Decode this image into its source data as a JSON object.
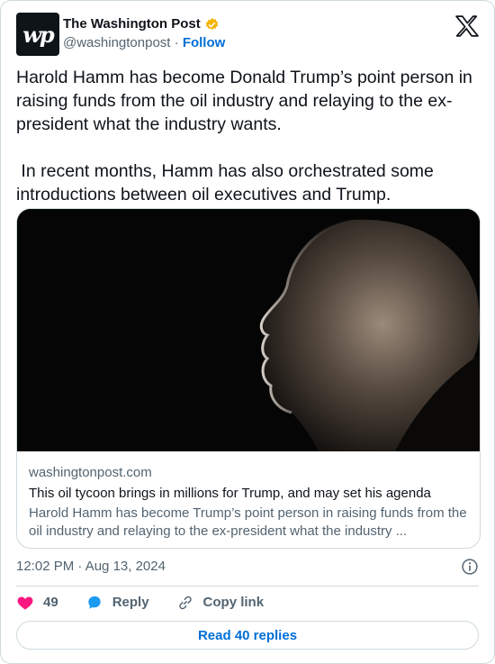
{
  "author": {
    "display_name": "The Washington Post",
    "handle": "@washingtonpost",
    "separator": "·",
    "follow_label": "Follow",
    "avatar_text": "wp",
    "verified_color": "#f4b400"
  },
  "tweet": {
    "text": "Harold Hamm has become Donald Trump’s point person in raising funds from the oil industry and relaying to the ex-president what the industry wants.\n\n In recent months, Hamm has also orchestrated some introductions between oil executives and Trump."
  },
  "link_card": {
    "domain": "washingtonpost.com",
    "title": "This oil tycoon brings in millions for Trump, and may set his agenda",
    "description": "Harold Hamm has become Trump’s point person in raising funds from the oil industry and relaying to the ex-president what the industry ..."
  },
  "timestamp": "12:02 PM · Aug 13, 2024",
  "actions": {
    "like_count": "49",
    "reply_label": "Reply",
    "copy_link_label": "Copy link"
  },
  "read_replies_label": "Read 40 replies",
  "colors": {
    "accent": "#006fd6",
    "like": "#f91880",
    "reply": "#1d9bf0",
    "muted": "#536471",
    "border": "#cfd9de"
  },
  "icons": [
    "x-logo-icon",
    "verified-badge-icon",
    "info-icon",
    "heart-icon",
    "reply-bubble-icon",
    "link-icon"
  ]
}
